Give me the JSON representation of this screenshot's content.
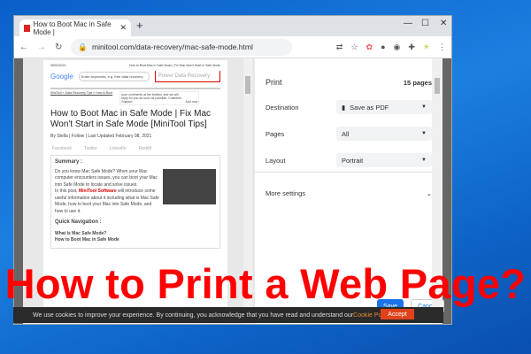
{
  "browser": {
    "tab_title": "How to Boot Mac in Safe Mode |",
    "url": "minitool.com/data-recovery/mac-safe-mode.html"
  },
  "page": {
    "date": "08/02/2021",
    "header": "How to Boot Mac in Safe Mode | Fix Mac Won't Start in Safe Mode",
    "search_placeholder": "Enter keywords, e.g. free data recovery",
    "google": "Google",
    "pdr": "Power Data Recovery",
    "breadcrumb": "MiniTool » Data Recovery Tips » How to Boot",
    "popup": "your comments at the bottom, and we will reply for you as soon as possible. Customer Support",
    "popup_time": "Just now",
    "title": "How to Boot Mac in Safe Mode | Fix Mac Won't Start in Safe Mode [MiniTool Tips]",
    "byline": "By Stella | Follow | Last Updated February 08, 2021",
    "share": [
      "Facebook",
      "Twitter",
      "LinkedIn",
      "Reddit"
    ],
    "summary_heading": "Summary :",
    "summary_text": "Do you know Mac Safe Mode? When your Mac computer encounters issues, you can boot your Mac into Safe Mode to locate and solve issues.",
    "summary_text2_a": "In this post, ",
    "summary_brand": "MiniTool Software",
    "summary_text2_b": " will introduce some useful information about it including what is Mac Safe Mode, how to boot your Mac into Safe Mode, and how to use it.",
    "quick_nav": "Quick Navigation :",
    "nav_items": [
      "What Is Mac Safe Mode?",
      "How to Boot Mac in Safe Mode"
    ]
  },
  "print": {
    "title": "Print",
    "pages_count": "15 pages",
    "destination_label": "Destination",
    "destination": "Save as PDF",
    "pages_label": "Pages",
    "pages": "All",
    "layout_label": "Layout",
    "layout": "Portrait",
    "more_settings": "More settings",
    "save": "Save",
    "cancel": "Cancel"
  },
  "cookie": {
    "text": "We use cookies to improve your experience. By continuing, you acknowledge that you have read and understand our ",
    "link": "Cookie Policy",
    "end": ".",
    "accept": "Accept"
  },
  "overlay_title": "How to Print a Web Page?"
}
